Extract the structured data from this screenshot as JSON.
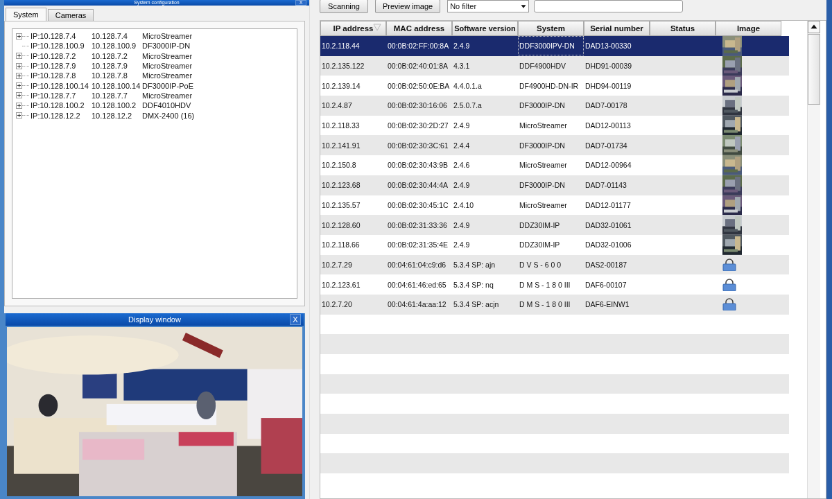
{
  "config_window": {
    "title": "System configuration",
    "close": "X",
    "tabs": [
      {
        "label": "System",
        "selected": true
      },
      {
        "label": "Cameras",
        "selected": false
      }
    ],
    "tree": [
      {
        "kind": "group",
        "name": "IP:10.128.7.4",
        "address": "10.128.7.4",
        "model": "MicroStreamer"
      },
      {
        "kind": "leaf",
        "name": "IP:10.128.100.9",
        "address": "10.128.100.9",
        "model": "DF3000IP-DN"
      },
      {
        "kind": "group",
        "name": "IP:10.128.7.2",
        "address": "10.128.7.2",
        "model": "MicroStreamer"
      },
      {
        "kind": "group",
        "name": "IP:10.128.7.9",
        "address": "10.128.7.9",
        "model": "MicroStreamer"
      },
      {
        "kind": "group",
        "name": "IP:10.128.7.8",
        "address": "10.128.7.8",
        "model": "MicroStreamer"
      },
      {
        "kind": "group",
        "name": "IP:10.128.100.14",
        "address": "10.128.100.14",
        "model": "DF3000IP-PoE"
      },
      {
        "kind": "group",
        "name": "IP:10.128.7.7",
        "address": "10.128.7.7",
        "model": "MicroStreamer"
      },
      {
        "kind": "group",
        "name": "IP:10.128.100.2",
        "address": "10.128.100.2",
        "model": "DDF4010HDV"
      },
      {
        "kind": "group",
        "name": "IP:10.128.12.2",
        "address": "10.128.12.2",
        "model": "DMX-2400 (16)"
      }
    ]
  },
  "display_window": {
    "title": "Display window",
    "close": "X",
    "kind": "picture"
  },
  "toolbar": {
    "buttons": [
      "Scanning",
      "Preview image"
    ],
    "filter": "No filter"
  },
  "table": {
    "columns": [
      "IP address",
      "MAC address",
      "Software version",
      "System",
      "Serial number",
      "Status",
      "Image"
    ],
    "rows": [
      {
        "selected": true,
        "ip": "10.2.118.44",
        "mac": "00:0B:02:FF:00:8A",
        "software": "2.4.9",
        "system": "DDF3000IPV-DN",
        "serial": "DAD13-00330",
        "kind": "picture"
      },
      {
        "selected": false,
        "ip": "10.2.135.122",
        "mac": "00:0B:02:40:01:8A",
        "software": "4.3.1",
        "system": "DDF4900HDV",
        "serial": "DHD91-00039",
        "kind": "picture"
      },
      {
        "selected": false,
        "ip": "10.2.139.14",
        "mac": "00:0B:02:50:0E:BA",
        "software": "4.4.0.1.a",
        "system": "DF4900HD-DN-IR",
        "serial": "DHD94-00119",
        "kind": "picture"
      },
      {
        "selected": false,
        "ip": "10.2.4.87",
        "mac": "00:0B:02:30:16:06",
        "software": "2.5.0.7.a",
        "system": "DF3000IP-DN",
        "serial": "DAD7-00178",
        "kind": "picture"
      },
      {
        "selected": false,
        "ip": "10.2.118.33",
        "mac": "00:0B:02:30:2D:27",
        "software": "2.4.9",
        "system": "MicroStreamer",
        "serial": "DAD12-00113",
        "kind": "picture"
      },
      {
        "selected": false,
        "ip": "10.2.141.91",
        "mac": "00:0B:02:30:3C:61",
        "software": "2.4.4",
        "system": "DF3000IP-DN",
        "serial": "DAD7-01734",
        "kind": "picture"
      },
      {
        "selected": false,
        "ip": "10.2.150.8",
        "mac": "00:0B:02:30:43:9B",
        "software": "2.4.6",
        "system": "MicroStreamer",
        "serial": "DAD12-00964",
        "kind": "picture"
      },
      {
        "selected": false,
        "ip": "10.2.123.68",
        "mac": "00:0B:02:30:44:4A",
        "software": "2.4.9",
        "system": "DF3000IP-DN",
        "serial": "DAD7-01143",
        "kind": "picture"
      },
      {
        "selected": false,
        "ip": "10.2.135.57",
        "mac": "00:0B:02:30:45:1C",
        "software": "2.4.10",
        "system": "MicroStreamer",
        "serial": "DAD12-01177",
        "kind": "picture"
      },
      {
        "selected": false,
        "ip": "10.2.128.60",
        "mac": "00:0B:02:31:33:36",
        "software": "2.4.9",
        "system": "DDZ30IM-IP",
        "serial": "DAD32-01061",
        "kind": "picture"
      },
      {
        "selected": false,
        "ip": "10.2.118.66",
        "mac": "00:0B:02:31:35:4E",
        "software": "2.4.9",
        "system": "DDZ30IM-IP",
        "serial": "DAD32-01006",
        "kind": "picture"
      },
      {
        "selected": false,
        "ip": "10.2.7.29",
        "mac": "00:04:61:04:c9:d6",
        "software": "5.3.4 SP:  ajn",
        "system": "D V S - 6 0 0",
        "serial": "DAS2-00187",
        "kind": "lock"
      },
      {
        "selected": false,
        "ip": "10.2.123.61",
        "mac": "00:04:61:46:ed:65",
        "software": "5.3.4 SP:  nq",
        "system": "D M S - 1 8 0 III",
        "serial": "DAF6-00107",
        "kind": "lock"
      },
      {
        "selected": false,
        "ip": "10.2.7.20",
        "mac": "00:04:61:4a:aa:12",
        "software": "5.3.4 SP:  acjn",
        "system": "D M S - 1 8 0 III",
        "serial": "DAF6-EINW1",
        "kind": "lock"
      }
    ]
  }
}
